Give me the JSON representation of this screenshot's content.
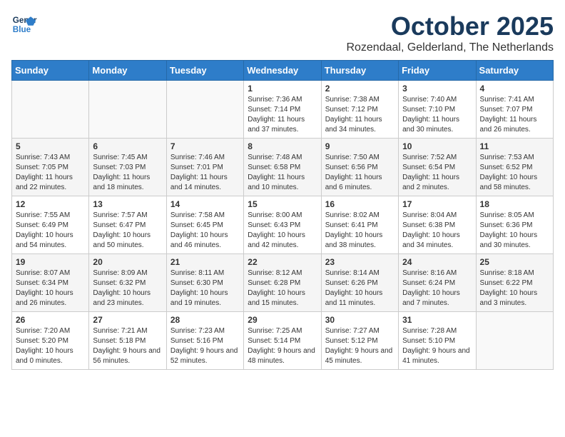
{
  "header": {
    "logo_line1": "General",
    "logo_line2": "Blue",
    "month": "October 2025",
    "location": "Rozendaal, Gelderland, The Netherlands"
  },
  "weekdays": [
    "Sunday",
    "Monday",
    "Tuesday",
    "Wednesday",
    "Thursday",
    "Friday",
    "Saturday"
  ],
  "weeks": [
    [
      {
        "num": "",
        "info": ""
      },
      {
        "num": "",
        "info": ""
      },
      {
        "num": "",
        "info": ""
      },
      {
        "num": "1",
        "info": "Sunrise: 7:36 AM\nSunset: 7:14 PM\nDaylight: 11 hours and 37 minutes."
      },
      {
        "num": "2",
        "info": "Sunrise: 7:38 AM\nSunset: 7:12 PM\nDaylight: 11 hours and 34 minutes."
      },
      {
        "num": "3",
        "info": "Sunrise: 7:40 AM\nSunset: 7:10 PM\nDaylight: 11 hours and 30 minutes."
      },
      {
        "num": "4",
        "info": "Sunrise: 7:41 AM\nSunset: 7:07 PM\nDaylight: 11 hours and 26 minutes."
      }
    ],
    [
      {
        "num": "5",
        "info": "Sunrise: 7:43 AM\nSunset: 7:05 PM\nDaylight: 11 hours and 22 minutes."
      },
      {
        "num": "6",
        "info": "Sunrise: 7:45 AM\nSunset: 7:03 PM\nDaylight: 11 hours and 18 minutes."
      },
      {
        "num": "7",
        "info": "Sunrise: 7:46 AM\nSunset: 7:01 PM\nDaylight: 11 hours and 14 minutes."
      },
      {
        "num": "8",
        "info": "Sunrise: 7:48 AM\nSunset: 6:58 PM\nDaylight: 11 hours and 10 minutes."
      },
      {
        "num": "9",
        "info": "Sunrise: 7:50 AM\nSunset: 6:56 PM\nDaylight: 11 hours and 6 minutes."
      },
      {
        "num": "10",
        "info": "Sunrise: 7:52 AM\nSunset: 6:54 PM\nDaylight: 11 hours and 2 minutes."
      },
      {
        "num": "11",
        "info": "Sunrise: 7:53 AM\nSunset: 6:52 PM\nDaylight: 10 hours and 58 minutes."
      }
    ],
    [
      {
        "num": "12",
        "info": "Sunrise: 7:55 AM\nSunset: 6:49 PM\nDaylight: 10 hours and 54 minutes."
      },
      {
        "num": "13",
        "info": "Sunrise: 7:57 AM\nSunset: 6:47 PM\nDaylight: 10 hours and 50 minutes."
      },
      {
        "num": "14",
        "info": "Sunrise: 7:58 AM\nSunset: 6:45 PM\nDaylight: 10 hours and 46 minutes."
      },
      {
        "num": "15",
        "info": "Sunrise: 8:00 AM\nSunset: 6:43 PM\nDaylight: 10 hours and 42 minutes."
      },
      {
        "num": "16",
        "info": "Sunrise: 8:02 AM\nSunset: 6:41 PM\nDaylight: 10 hours and 38 minutes."
      },
      {
        "num": "17",
        "info": "Sunrise: 8:04 AM\nSunset: 6:38 PM\nDaylight: 10 hours and 34 minutes."
      },
      {
        "num": "18",
        "info": "Sunrise: 8:05 AM\nSunset: 6:36 PM\nDaylight: 10 hours and 30 minutes."
      }
    ],
    [
      {
        "num": "19",
        "info": "Sunrise: 8:07 AM\nSunset: 6:34 PM\nDaylight: 10 hours and 26 minutes."
      },
      {
        "num": "20",
        "info": "Sunrise: 8:09 AM\nSunset: 6:32 PM\nDaylight: 10 hours and 23 minutes."
      },
      {
        "num": "21",
        "info": "Sunrise: 8:11 AM\nSunset: 6:30 PM\nDaylight: 10 hours and 19 minutes."
      },
      {
        "num": "22",
        "info": "Sunrise: 8:12 AM\nSunset: 6:28 PM\nDaylight: 10 hours and 15 minutes."
      },
      {
        "num": "23",
        "info": "Sunrise: 8:14 AM\nSunset: 6:26 PM\nDaylight: 10 hours and 11 minutes."
      },
      {
        "num": "24",
        "info": "Sunrise: 8:16 AM\nSunset: 6:24 PM\nDaylight: 10 hours and 7 minutes."
      },
      {
        "num": "25",
        "info": "Sunrise: 8:18 AM\nSunset: 6:22 PM\nDaylight: 10 hours and 3 minutes."
      }
    ],
    [
      {
        "num": "26",
        "info": "Sunrise: 7:20 AM\nSunset: 5:20 PM\nDaylight: 10 hours and 0 minutes."
      },
      {
        "num": "27",
        "info": "Sunrise: 7:21 AM\nSunset: 5:18 PM\nDaylight: 9 hours and 56 minutes."
      },
      {
        "num": "28",
        "info": "Sunrise: 7:23 AM\nSunset: 5:16 PM\nDaylight: 9 hours and 52 minutes."
      },
      {
        "num": "29",
        "info": "Sunrise: 7:25 AM\nSunset: 5:14 PM\nDaylight: 9 hours and 48 minutes."
      },
      {
        "num": "30",
        "info": "Sunrise: 7:27 AM\nSunset: 5:12 PM\nDaylight: 9 hours and 45 minutes."
      },
      {
        "num": "31",
        "info": "Sunrise: 7:28 AM\nSunset: 5:10 PM\nDaylight: 9 hours and 41 minutes."
      },
      {
        "num": "",
        "info": ""
      }
    ]
  ]
}
